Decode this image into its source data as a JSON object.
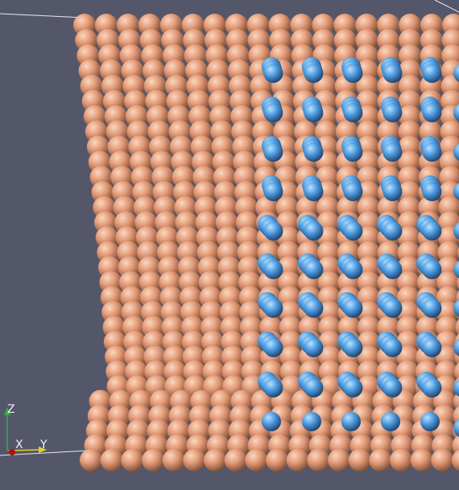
{
  "viewport": {
    "background": "#54576a",
    "atom_colors": {
      "substrate": "#e29a77",
      "substrate_highlight": "#fbd6bf",
      "substrate_shade": "#7a4a33",
      "solute": "#4d9be0",
      "solute_highlight": "#b9e1ff",
      "solute_shade": "#1d3d66"
    }
  },
  "orientation_axes": {
    "x_label": "X",
    "y_label": "Y",
    "z_label": "Z",
    "x_color": "#d4251f",
    "y_color": "#e6cf2a",
    "z_color": "#2fb24a"
  }
}
